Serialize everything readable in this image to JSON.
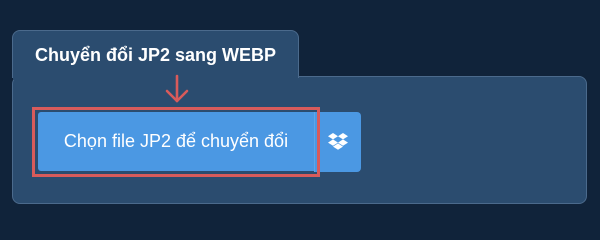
{
  "converter": {
    "tab_title": "Chuyển đổi JP2 sang WEBP",
    "choose_button_label": "Chọn file JP2 để chuyển đổi",
    "dropbox_icon": "dropbox-icon",
    "arrow_icon": "down-arrow-icon"
  },
  "colors": {
    "page_background": "#10233a",
    "panel_background": "#2b4c6f",
    "button_blue": "#4b98e3",
    "highlight_red": "#d85b5b"
  }
}
